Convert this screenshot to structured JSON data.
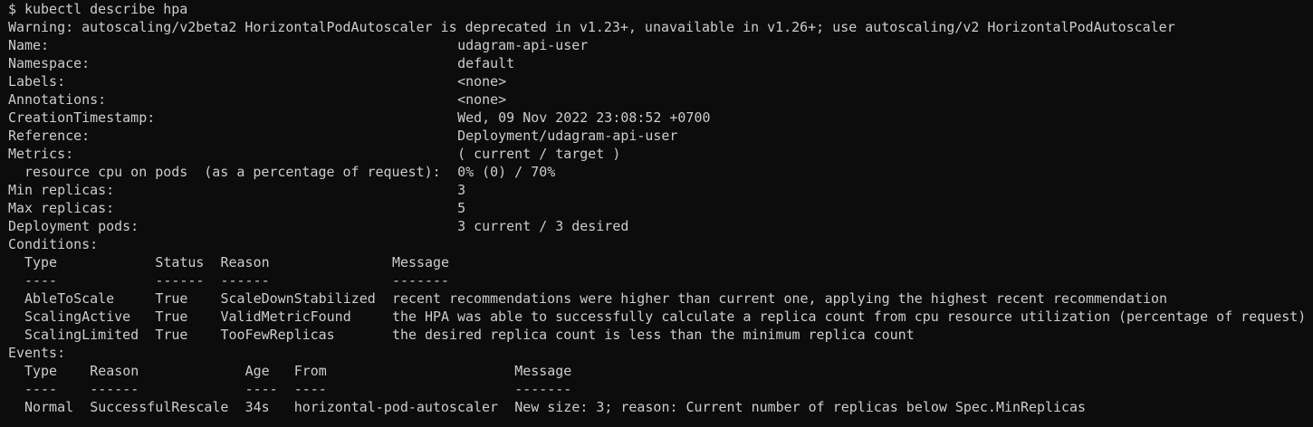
{
  "terminal": {
    "lines": [
      {
        "text": "$ kubectl describe hpa"
      },
      {
        "text": "Warning: autoscaling/v2beta2 HorizontalPodAutoscaler is deprecated in v1.23+, unavailable in v1.26+; use autoscaling/v2 HorizontalPodAutoscaler"
      },
      {
        "cols": [
          "Name:",
          "udagram-api-user"
        ]
      },
      {
        "cols": [
          "Namespace:",
          "default"
        ]
      },
      {
        "cols": [
          "Labels:",
          "<none>"
        ]
      },
      {
        "cols": [
          "Annotations:",
          "<none>"
        ]
      },
      {
        "cols": [
          "CreationTimestamp:",
          "Wed, 09 Nov 2022 23:08:52 +0700"
        ]
      },
      {
        "cols": [
          "Reference:",
          "Deployment/udagram-api-user"
        ]
      },
      {
        "cols": [
          "Metrics:",
          "( current / target )"
        ]
      },
      {
        "cols": [
          "  resource cpu on pods  (as a percentage of request):",
          "0% (0) / 70%"
        ]
      },
      {
        "cols": [
          "Min replicas:",
          "3"
        ]
      },
      {
        "cols": [
          "Max replicas:",
          "5"
        ]
      },
      {
        "cols": [
          "Deployment pods:",
          "3 current / 3 desired"
        ]
      },
      {
        "text": "Conditions:"
      },
      {
        "cols": [
          "  Type",
          "Status",
          "Reason",
          "Message"
        ]
      },
      {
        "cols": [
          "  ----",
          "------",
          "------",
          "-------"
        ]
      },
      {
        "cols": [
          "  AbleToScale",
          "True",
          "ScaleDownStabilized",
          "recent recommendations were higher than current one, applying the highest recent recommendation"
        ]
      },
      {
        "cols": [
          "  ScalingActive",
          "True",
          "ValidMetricFound",
          "the HPA was able to successfully calculate a replica count from cpu resource utilization (percentage of request)"
        ]
      },
      {
        "cols": [
          "  ScalingLimited",
          "True",
          "TooFewReplicas",
          "the desired replica count is less than the minimum replica count"
        ]
      },
      {
        "text": "Events:"
      },
      {
        "cols": [
          "  Type",
          "Reason",
          "Age",
          "From",
          "Message"
        ]
      },
      {
        "cols": [
          "  ----",
          "------",
          "----",
          "----",
          "-------"
        ]
      },
      {
        "cols": [
          "  Normal",
          "SuccessfulRescale",
          "34s",
          "horizontal-pod-autoscaler",
          "New size: 3; reason: Current number of replicas below Spec.MinReplicas"
        ]
      }
    ]
  }
}
